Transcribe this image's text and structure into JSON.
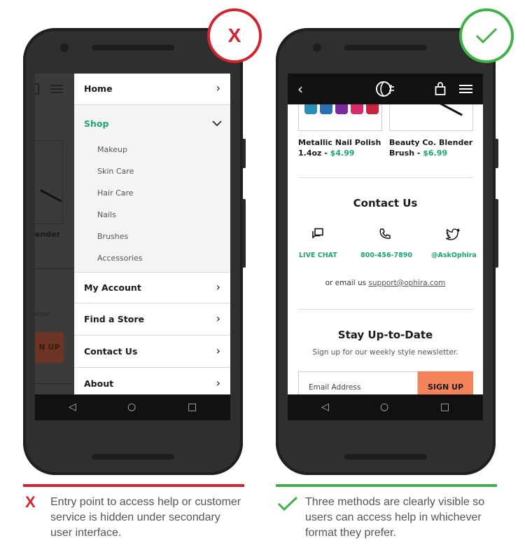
{
  "colors": {
    "bad": "#d3232c",
    "good": "#3fb24a",
    "accent_green": "#1aa672",
    "signup": "#f4825a"
  },
  "bad_example": {
    "badge_text": "X",
    "menu": {
      "home": "Home",
      "shop": "Shop",
      "shop_items": [
        "Makeup",
        "Skin Care",
        "Hair Care",
        "Nails",
        "Brushes",
        "Accessories"
      ],
      "my_account": "My Account",
      "find_store": "Find a Store",
      "contact_us": "Contact Us",
      "about": "About"
    },
    "bg_fragments": {
      "product": "ender",
      "letter": "etter.",
      "button": "N UP"
    },
    "caption": {
      "icon": "X",
      "text": "Entry point to access help or customer service is hidden under secondary user interface."
    }
  },
  "good_example": {
    "badge_icon": "checkmark-icon",
    "products": [
      {
        "name": "Metallic Nail Polish",
        "size": "1.4oz - ",
        "price": "$4.99"
      },
      {
        "name": "Beauty Co. Blender",
        "size": "Brush - ",
        "price": "$6.99"
      }
    ],
    "contact": {
      "title": "Contact Us",
      "methods": [
        {
          "icon": "chat-icon",
          "label": "LIVE CHAT"
        },
        {
          "icon": "phone-icon",
          "label": "800-456-7890"
        },
        {
          "icon": "twitter-icon",
          "label": "@AskOphira"
        }
      ],
      "email_prefix": "or email us ",
      "email": "support@ophira.com"
    },
    "newsletter": {
      "title": "Stay Up-to-Date",
      "subtitle": "Sign up for our weekly style newsletter.",
      "placeholder": "Email Address",
      "button": "SIGN UP"
    },
    "caption": {
      "icon": "checkmark-icon",
      "text": "Three methods are clearly visible so users can access help in whichever format they prefer."
    }
  }
}
